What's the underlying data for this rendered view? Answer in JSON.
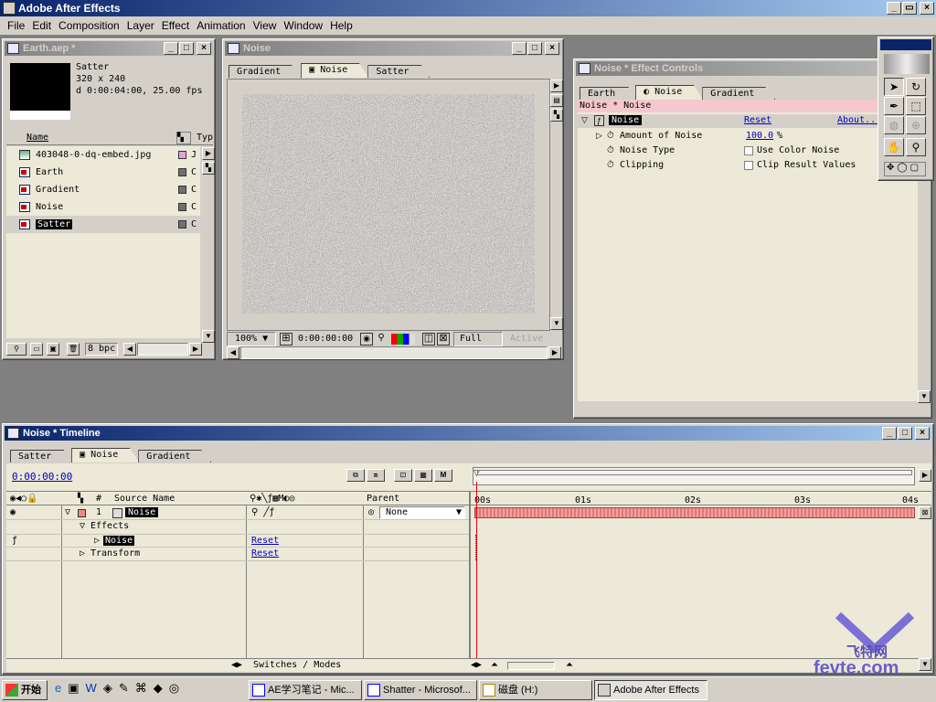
{
  "app": {
    "title": "Adobe After Effects"
  },
  "menu": [
    "File",
    "Edit",
    "Composition",
    "Layer",
    "Effect",
    "Animation",
    "View",
    "Window",
    "Help"
  ],
  "project": {
    "title": "Earth.aep *",
    "preview": {
      "name": "Satter",
      "size": "320 x 240",
      "duration": "d 0:00:04:00, 25.00 fps"
    },
    "col_name": "Name",
    "col_type": "Typ",
    "items": [
      {
        "name": "403048-0-dq-embed.jpg",
        "type": "J",
        "icon": "jpg-file-icon",
        "swatch": "#e8a0e0"
      },
      {
        "name": "Earth",
        "type": "C",
        "icon": "composition-icon",
        "swatch": "#707070"
      },
      {
        "name": "Gradient",
        "type": "C",
        "icon": "composition-icon",
        "swatch": "#707070"
      },
      {
        "name": "Noise",
        "type": "C",
        "icon": "composition-icon",
        "swatch": "#707070"
      },
      {
        "name": "Satter",
        "type": "C",
        "icon": "composition-icon",
        "swatch": "#707070"
      }
    ],
    "bpc": "8 bpc"
  },
  "comp": {
    "title": "Noise",
    "tabs": [
      "Gradient",
      "Noise",
      "Satter"
    ],
    "zoom": "100%",
    "timecode": "0:00:00:00",
    "resolution": "Full",
    "view": "Active"
  },
  "effect_controls": {
    "title": "Noise * Effect Controls",
    "tabs": [
      "Earth",
      "Noise",
      "Gradient"
    ],
    "header": "Noise * Noise",
    "effect_name": "Noise",
    "reset": "Reset",
    "about": "About...",
    "params": [
      {
        "label": "Amount of Noise",
        "value": "100.0",
        "unit": "%"
      },
      {
        "label": "Noise Type",
        "check_label": "Use Color Noise"
      },
      {
        "label": "Clipping",
        "check_label": "Clip Result Values"
      }
    ]
  },
  "timeline": {
    "title": "Noise * Timeline",
    "tabs": [
      "Satter",
      "Noise",
      "Gradient"
    ],
    "timecode": "0:00:00:00",
    "col_hash": "#",
    "col_source": "Source Name",
    "col_parent": "Parent",
    "ruler": [
      "00s",
      "01s",
      "02s",
      "03s",
      "04s"
    ],
    "layer": {
      "index": "1",
      "name": "Noise",
      "parent": "None"
    },
    "effects_label": "Effects",
    "effect_item": "Noise",
    "transform_label": "Transform",
    "reset1": "Reset",
    "reset2": "Reset",
    "switches_modes": "Switches / Modes"
  },
  "taskbar": {
    "start": "开始",
    "items": [
      "AE学习笔记 - Mic...",
      "Shatter - Microsof...",
      "磁盘 (H:)",
      "Adobe After Effects"
    ]
  },
  "watermark": {
    "brand": "飞特网",
    "domain": "fevte.com"
  }
}
